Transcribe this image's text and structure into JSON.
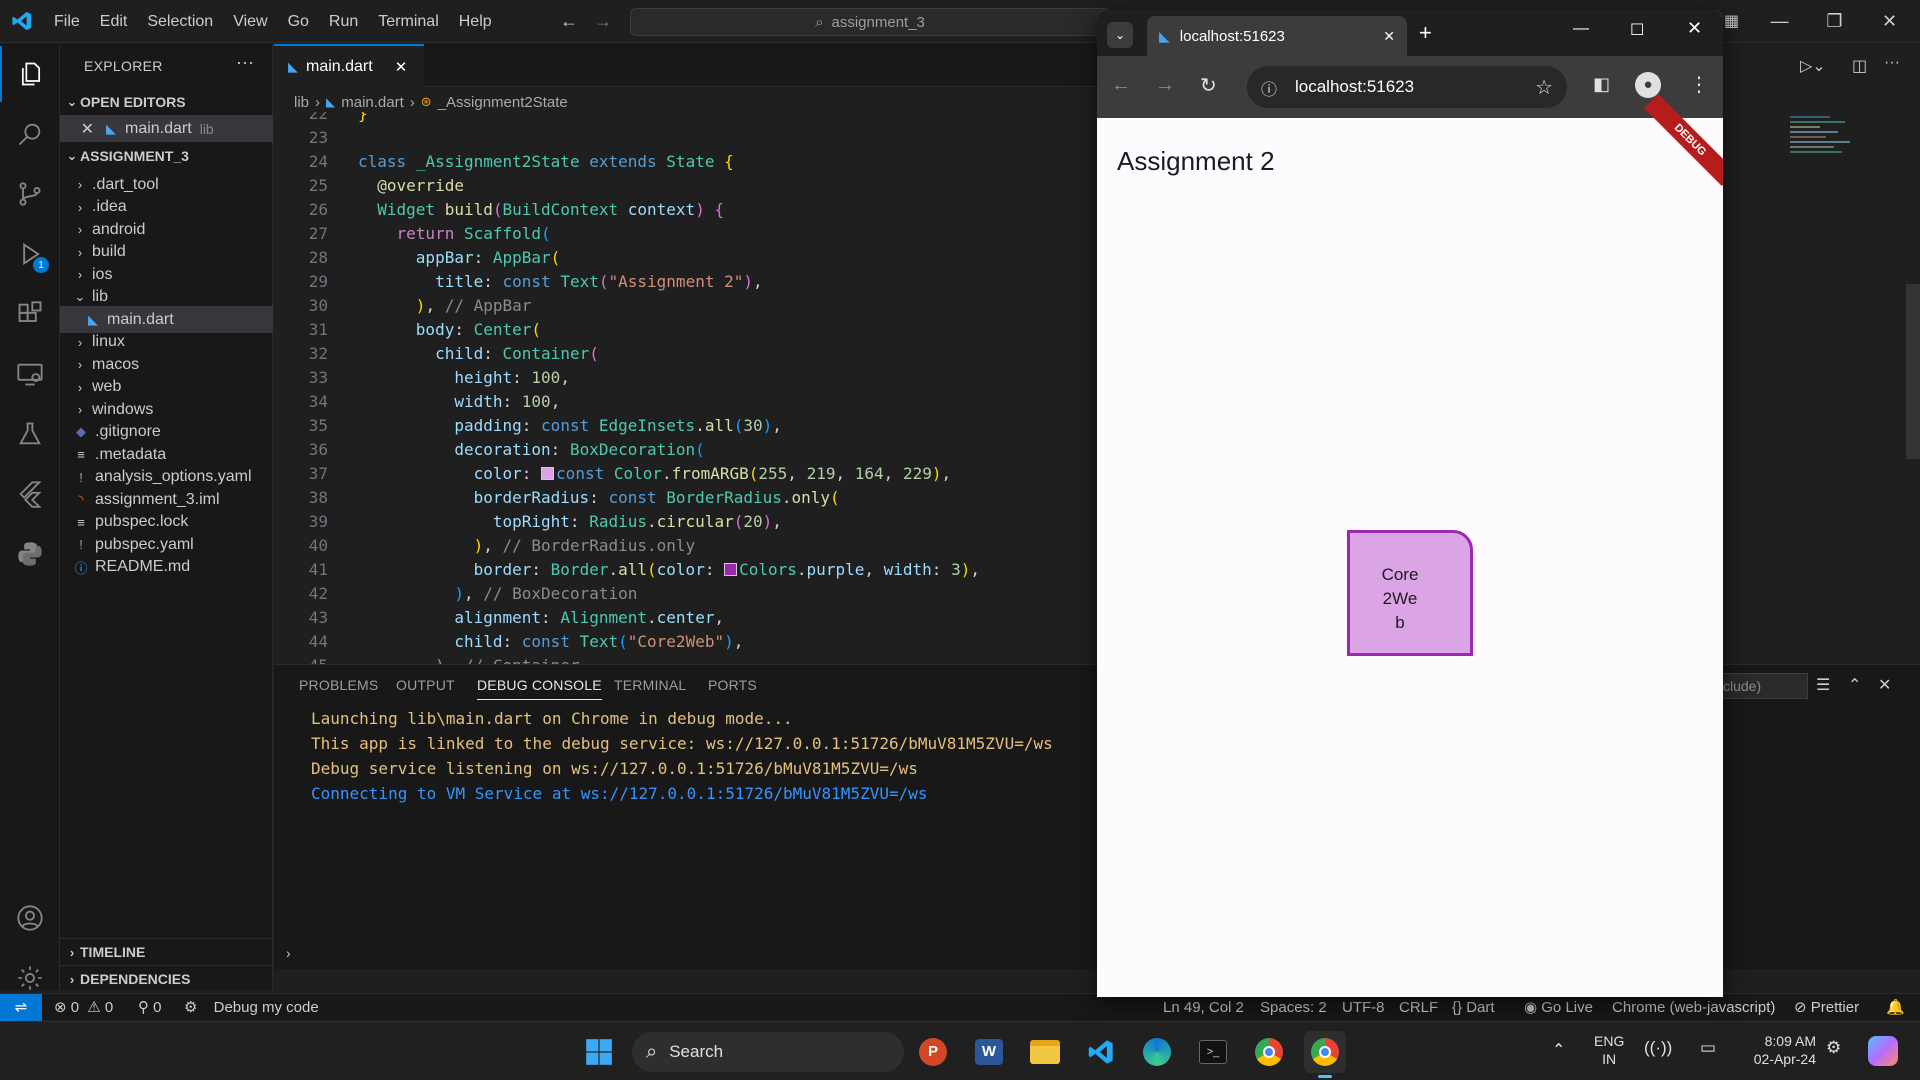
{
  "titlebar": {
    "menus": [
      "File",
      "Edit",
      "Selection",
      "View",
      "Go",
      "Run",
      "Terminal",
      "Help"
    ],
    "search_text": "assignment_3"
  },
  "activity_bar": {
    "icons": [
      "explorer-icon",
      "search-icon",
      "source-control-icon",
      "run-debug-icon",
      "extensions-icon",
      "remote-explorer-icon",
      "testing-icon",
      "flutter-icon",
      "python-icon",
      "account-icon",
      "settings-gear-icon"
    ],
    "debug_badge": "1"
  },
  "sidebar": {
    "title": "EXPLORER",
    "more": "···",
    "open_editors_label": "OPEN EDITORS",
    "open_editor": {
      "name": "main.dart",
      "folder": "lib"
    },
    "project_label": "ASSIGNMENT_3",
    "items": [
      {
        "label": ".dart_tool",
        "kind": "folder"
      },
      {
        "label": ".idea",
        "kind": "folder"
      },
      {
        "label": "android",
        "kind": "folder"
      },
      {
        "label": "build",
        "kind": "folder"
      },
      {
        "label": "ios",
        "kind": "folder"
      },
      {
        "label": "lib",
        "kind": "folder-open"
      },
      {
        "label": "main.dart",
        "kind": "dart"
      },
      {
        "label": "linux",
        "kind": "folder"
      },
      {
        "label": "macos",
        "kind": "folder"
      },
      {
        "label": "web",
        "kind": "folder"
      },
      {
        "label": "windows",
        "kind": "folder"
      },
      {
        "label": ".gitignore",
        "kind": "git"
      },
      {
        "label": ".metadata",
        "kind": "text"
      },
      {
        "label": "analysis_options.yaml",
        "kind": "yaml"
      },
      {
        "label": "assignment_3.iml",
        "kind": "rss"
      },
      {
        "label": "pubspec.lock",
        "kind": "text"
      },
      {
        "label": "pubspec.yaml",
        "kind": "yaml"
      },
      {
        "label": "README.md",
        "kind": "info"
      }
    ],
    "timeline_label": "TIMELINE",
    "dependencies_label": "DEPENDENCIES"
  },
  "editor": {
    "tab_label": "main.dart",
    "breadcrumb": [
      "lib",
      "main.dart",
      "_Assignment2State"
    ],
    "line_numbers": [
      "22",
      "23",
      "24",
      "25",
      "26",
      "27",
      "28",
      "29",
      "30",
      "31",
      "32",
      "33",
      "34",
      "35",
      "36",
      "37",
      "38",
      "39",
      "40",
      "41",
      "42",
      "43",
      "44",
      "45"
    ]
  },
  "panel": {
    "tabs": [
      "PROBLEMS",
      "OUTPUT",
      "DEBUG CONSOLE",
      "TERMINAL",
      "PORTS"
    ],
    "filter_placeholder": "clude)",
    "logs": [
      {
        "text": "Launching lib\\main.dart on Chrome in debug mode...",
        "color": "#e5c07b"
      },
      {
        "text": "This app is linked to the debug service: ws://127.0.0.1:51726/bMuV81M5ZVU=/ws",
        "color": "#e5c07b"
      },
      {
        "text": "Debug service listening on ws://127.0.0.1:51726/bMuV81M5ZVU=/ws",
        "color": "#e5c07b"
      },
      {
        "text": "Connecting to VM Service at ws://127.0.0.1:51726/bMuV81M5ZVU=/ws",
        "color": "#3794ff"
      }
    ]
  },
  "statusbar": {
    "errors": "0",
    "warnings": "0",
    "ports": "0",
    "debug_label": "Debug my code",
    "position": "Ln 49, Col 2",
    "spaces": "Spaces: 2",
    "encoding": "UTF-8",
    "eol": "CRLF",
    "language": "Dart",
    "go_live": "Go Live",
    "device": "Chrome (web-javascript)",
    "prettier": "Prettier"
  },
  "browser": {
    "tab_title": "localhost:51623",
    "url": "localhost:51623",
    "app_title": "Assignment 2",
    "box_text": "Core2Web",
    "debug_banner": "DEBUG",
    "box_fill": "#dba4e5",
    "box_border": "#9c27b0"
  },
  "taskbar": {
    "search_label": "Search",
    "lang_top": "ENG",
    "lang_bottom": "IN",
    "time": "8:09 AM",
    "date": "02-Apr-24"
  },
  "colors": {
    "accent": "#0078d4",
    "editor_bg": "#1f1f1f"
  }
}
